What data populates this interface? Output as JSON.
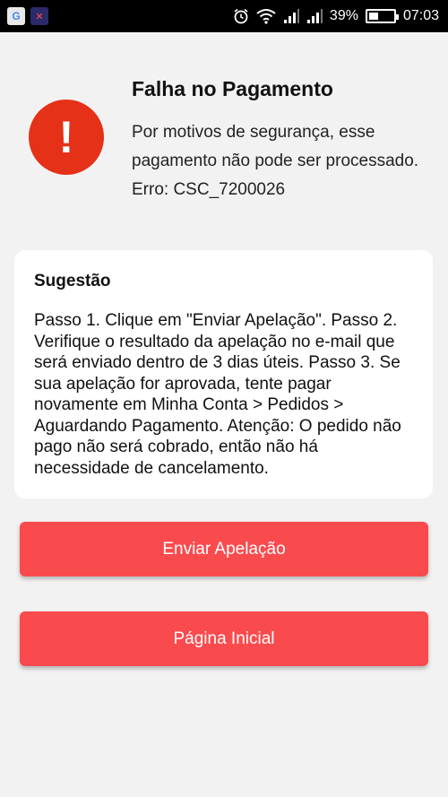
{
  "status_bar": {
    "app_icons": [
      "google-icon",
      "app-icon"
    ],
    "battery_percent": "39%",
    "battery_level": 0.39,
    "time": "07:03"
  },
  "header": {
    "title": "Falha no Pagamento",
    "message": "Por motivos de segurança, esse pagamento não pode ser processado.",
    "error_code": "Erro: CSC_7200026",
    "icon": "alert-exclamation-icon",
    "icon_color": "#e53118"
  },
  "suggestion": {
    "title": "Sugestão",
    "body": "Passo 1. Clique em \"Enviar Apelação\". Passo 2. Verifique o resultado da apelação no e-mail que será enviado dentro de 3 dias úteis. Passo 3. Se sua apelação for aprovada, tente pagar novamente em Minha Conta > Pedidos > Aguardando Pagamento. Atenção: O pedido não pago não será cobrado, então não há necessidade de cancelamento."
  },
  "buttons": {
    "appeal_label": "Enviar Apelação",
    "home_label": "Página Inicial",
    "color": "#f94b4e"
  }
}
